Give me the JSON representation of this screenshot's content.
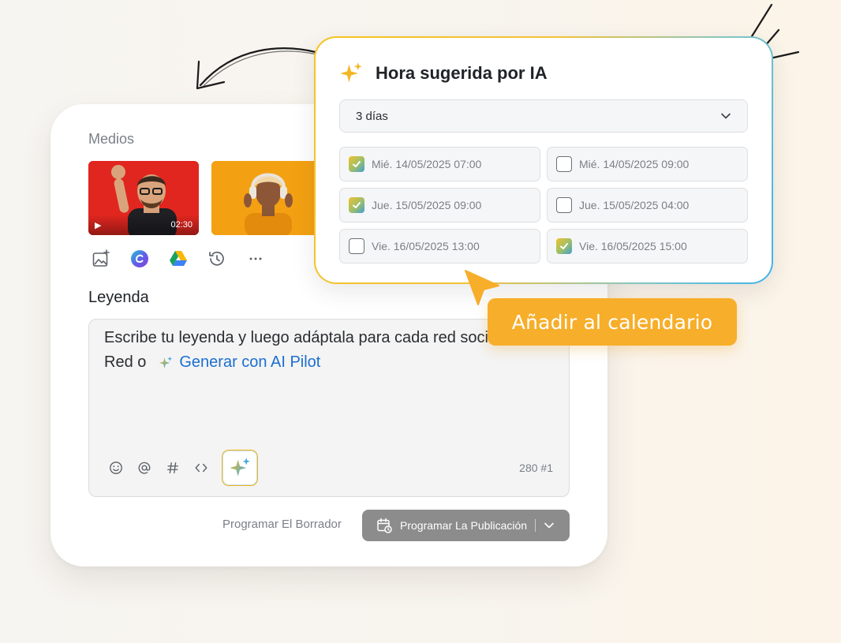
{
  "composer": {
    "media_label": "Medios",
    "video_duration": "02:30",
    "tools": [
      "image-add-icon",
      "canva-icon",
      "google-drive-icon",
      "history-icon",
      "more-icon"
    ],
    "caption_label": "Leyenda",
    "caption_placeholder_line1": "Escribe tu leyenda y luego adáptala para cada red social.",
    "caption_placeholder_line2_prefix": "Red o",
    "ai_generate_link": "Generar con AI Pilot",
    "caption_tools": [
      "emoji-icon",
      "mention-icon",
      "hashtag-icon",
      "code-icon",
      "ai-sparkle-icon"
    ],
    "char_count": "280 #1",
    "draft_button": "Programar El Borrador",
    "schedule_button": "Programar La Publicación"
  },
  "ai_popup": {
    "title": "Hora sugerida por IA",
    "range_select": "3 días",
    "slots": [
      {
        "label": "Mié. 14/05/2025 07:00",
        "checked": true
      },
      {
        "label": "Mié. 14/05/2025 09:00",
        "checked": false
      },
      {
        "label": "Jue. 15/05/2025 09:00",
        "checked": true
      },
      {
        "label": "Jue. 15/05/2025 04:00",
        "checked": false
      },
      {
        "label": "Vie. 16/05/2025 13:00",
        "checked": false
      },
      {
        "label": "Vie. 16/05/2025 15:00",
        "checked": true
      }
    ]
  },
  "badge": {
    "label": "Añadir al calendario"
  },
  "colors": {
    "accent_yellow": "#f7ae2a",
    "link_blue": "#1a6fd1",
    "schedule_button_bg": "#8c8c8c",
    "popup_gradient_start": "#f6c322",
    "popup_gradient_end": "#3fb4ec"
  }
}
